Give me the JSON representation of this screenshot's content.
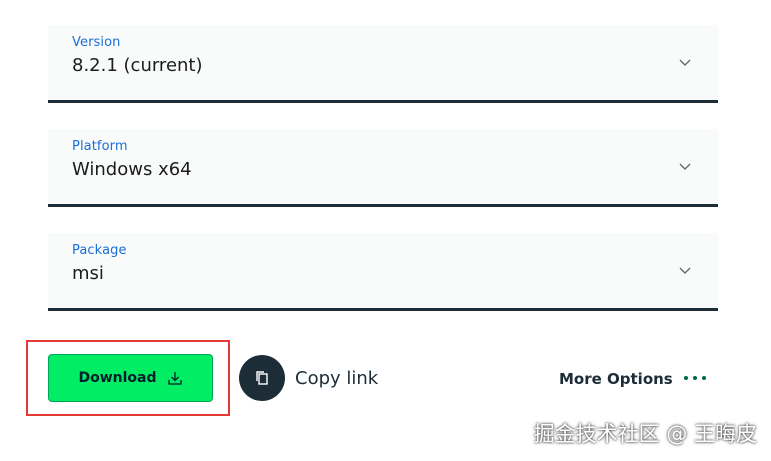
{
  "selects": {
    "version": {
      "label": "Version",
      "value": "8.2.1 (current)"
    },
    "platform": {
      "label": "Platform",
      "value": "Windows x64"
    },
    "package": {
      "label": "Package",
      "value": "msi"
    }
  },
  "actions": {
    "download_label": "Download",
    "copy_link_label": "Copy link",
    "more_options_label": "More Options"
  },
  "watermark": "掘金技术社区 @ 王晦皮",
  "colors": {
    "accent_label": "#1a6ed8",
    "download_bg": "#00ed64",
    "dark": "#1c2d38",
    "highlight": "#e53935",
    "dots": "#00684a"
  },
  "icons": {
    "chevron": "chevron-down-icon",
    "download": "download-icon",
    "copy": "copy-icon",
    "more": "more-dots-icon"
  }
}
